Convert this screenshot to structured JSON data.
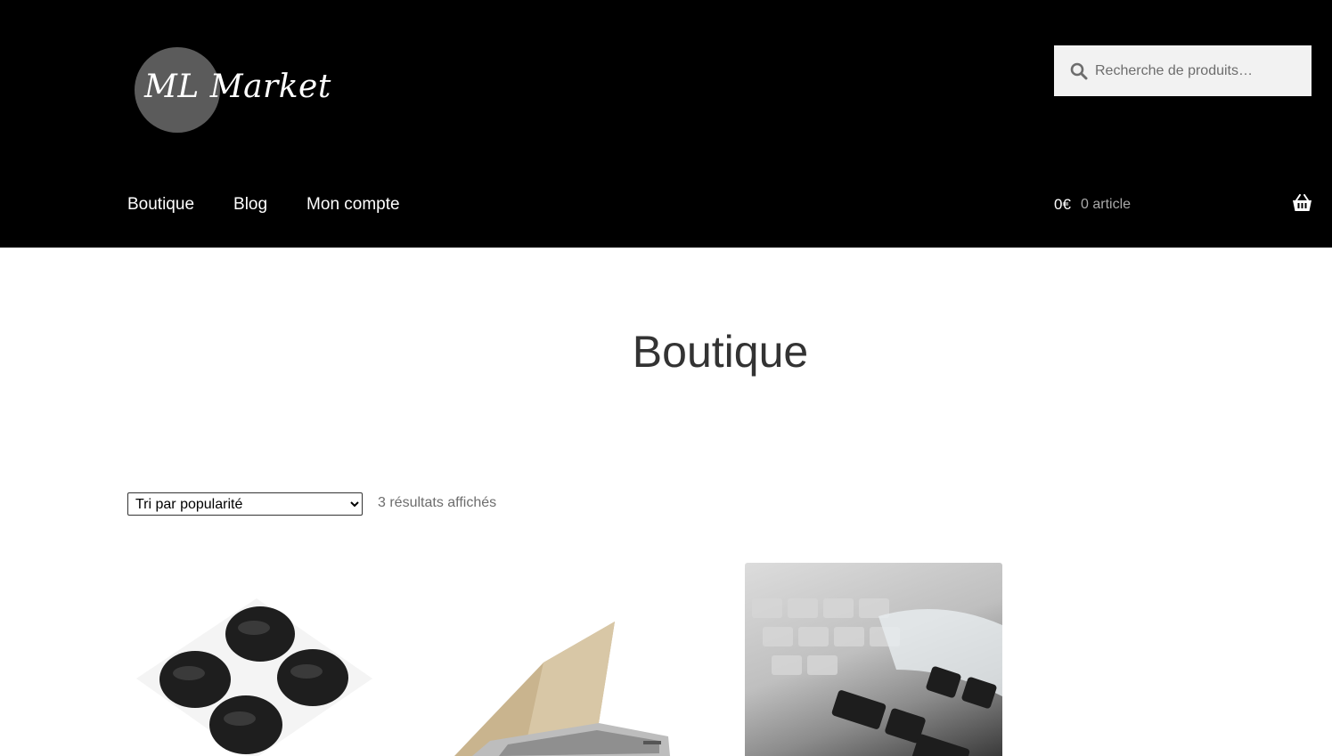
{
  "site": {
    "logo_text": "ML Market"
  },
  "search": {
    "placeholder": "Recherche de produits…"
  },
  "nav": {
    "items": [
      {
        "label": "Boutique"
      },
      {
        "label": "Blog"
      },
      {
        "label": "Mon compte"
      }
    ]
  },
  "cart": {
    "amount": "0€",
    "count": "0 article"
  },
  "page": {
    "title": "Boutique"
  },
  "toolbar": {
    "sort_selected": "Tri par popularité",
    "result_count": "3 résultats affichés"
  },
  "products": [
    {
      "image": "rubber-feet-image"
    },
    {
      "image": "laptop-shell-image"
    },
    {
      "image": "keyboard-cover-image"
    }
  ],
  "colors": {
    "header_bg": "#000000",
    "search_bg": "#f2f2f2",
    "logo_circle": "#5b5b5b"
  }
}
